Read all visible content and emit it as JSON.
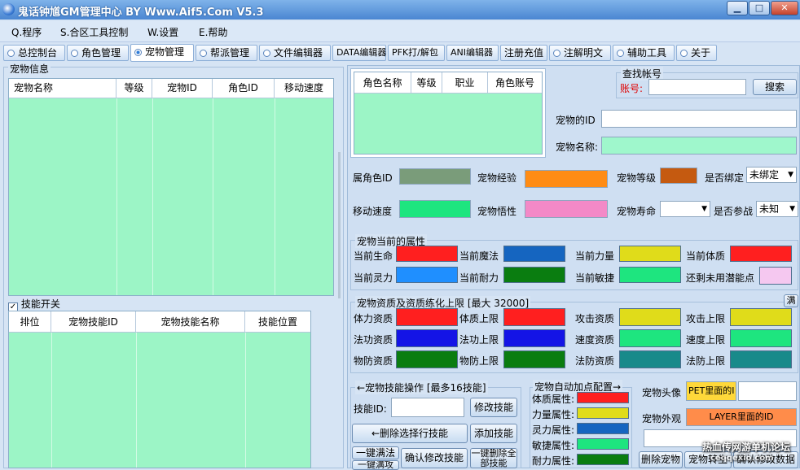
{
  "window": {
    "title": "鬼话钟馗GM管理中心 BY Www.Aif5.Com V5.3",
    "min": "▁",
    "max": "□",
    "close": "✕"
  },
  "menu": [
    "Q.程序",
    "S.合区工具控制",
    "W.设置",
    "E.帮助"
  ],
  "tabs": [
    "总控制台",
    "角色管理",
    "宠物管理",
    "帮派管理",
    "文件编辑器",
    "DATA编辑器",
    "PFK打/解包",
    "ANI编辑器",
    "注册充值",
    "注解明文",
    "辅助工具",
    "关于"
  ],
  "left": {
    "group_title": "宠物信息",
    "pet_cols": [
      "宠物名称",
      "等级",
      "宠物ID",
      "角色ID",
      "移动速度"
    ],
    "skill_check": "技能开关",
    "skill_cols": [
      "排位",
      "宠物技能ID",
      "宠物技能名称",
      "技能位置"
    ]
  },
  "right": {
    "role_cols": [
      "角色名称",
      "等级",
      "职业",
      "角色账号"
    ],
    "find": {
      "title": "查找帐号",
      "label": "账号:",
      "value": "",
      "button": "搜索"
    },
    "pet_id_label": "宠物的ID",
    "pet_id_value": "",
    "pet_name_label": "宠物名称:",
    "pet_name_value": "",
    "row1": {
      "owner": "属角色ID",
      "exp": "宠物经验",
      "level": "宠物等级",
      "bound": "是否绑定",
      "bound_value": "未绑定"
    },
    "row2": {
      "speed": "移动速度",
      "wisdom": "宠物悟性",
      "life": "宠物寿命",
      "battle": "是否参战",
      "battle_value": "未知"
    },
    "attr": {
      "title": "宠物当前的属性",
      "labels": [
        "当前生命",
        "当前魔法",
        "当前力量",
        "当前体质",
        "当前灵力",
        "当前耐力",
        "当前敏捷",
        "还剩未用潜能点"
      ],
      "colors": [
        "#ff1f1f",
        "#1565c0",
        "#e0dc1a",
        "#ff1f1f",
        "#1f8fff",
        "#0a7d10",
        "#1ee57f",
        "#f5c8f0"
      ]
    },
    "apt": {
      "title": "宠物资质及资质练化上限 [最大 32000]",
      "full": "满",
      "labels": [
        "体力资质",
        "体质上限",
        "攻击资质",
        "攻击上限",
        "法功资质",
        "法功上限",
        "速度资质",
        "速度上限",
        "物防资质",
        "物防上限",
        "法防资质",
        "法防上限"
      ],
      "colors": [
        "#ff1f1f",
        "#ff1f1f",
        "#e0dc1a",
        "#e0dc1a",
        "#1414e6",
        "#1414e6",
        "#1ee57f",
        "#1ee57f",
        "#0a7d10",
        "#0a7d10",
        "#188a8a",
        "#188a8a"
      ]
    },
    "skill_op": {
      "title": "←宠物技能操作 [最多16技能]",
      "id_label": "技能ID:",
      "id_value": "",
      "modify": "修改技能",
      "delete_sel": "←删除选择行技能",
      "add": "添加技能",
      "one_full": "一键满法",
      "one_xing": "一键满攻",
      "confirm": "确认修改技能",
      "del_all": "一键删除全部技能"
    },
    "auto": {
      "title": "宠物自动加点配置→",
      "labels": [
        "体质属性:",
        "力量属性:",
        "灵力属性:",
        "敏捷属性:",
        "耐力属性:"
      ],
      "colors": [
        "#ff1f1f",
        "#e0dc1a",
        "#1565c0",
        "#1ee57f",
        "#0a7d10"
      ]
    },
    "avatar": {
      "label": "宠物头像",
      "value": "PET里面的I",
      "outlook": "宠物外观",
      "outlook_value": "LAYER里面的ID"
    },
    "bottom_btns": [
      "删除宠物",
      "宠物转生",
      "确认修改数据"
    ],
    "watermark": "热血传网游单机论坛",
    "watermark2": "ceqqexio.com"
  }
}
